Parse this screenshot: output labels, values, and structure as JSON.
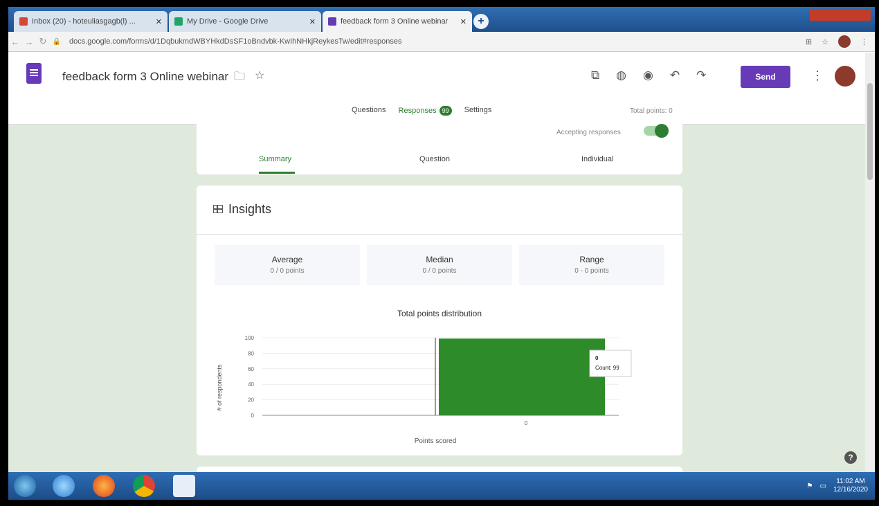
{
  "browser": {
    "tabs": [
      {
        "title": "Inbox (20) - hoteuliasgagb(l) ..."
      },
      {
        "title": "My Drive - Google Drive"
      },
      {
        "title": "feedback form 3 Online webinar"
      }
    ],
    "url": "docs.google.com/forms/d/1DqbukmdWBYHkdDsSF1oBndvbk-KwIhNHkjReykesTw/edit#responses"
  },
  "form": {
    "title": "feedback form 3 Online webinar",
    "send_label": "Send",
    "tabs": {
      "questions": "Questions",
      "responses": "Responses",
      "settings": "Settings"
    },
    "response_count": "99",
    "total_points": "Total points: 0",
    "accepting_label": "Accepting responses"
  },
  "responses": {
    "subtabs": {
      "summary": "Summary",
      "question": "Question",
      "individual": "Individual"
    },
    "insights_title": "Insights",
    "stats": [
      {
        "label": "Average",
        "value": "0 / 0 points"
      },
      {
        "label": "Median",
        "value": "0 / 0 points"
      },
      {
        "label": "Range",
        "value": "0 - 0 points"
      }
    ]
  },
  "chart_data": {
    "type": "bar",
    "title": "Total points distribution",
    "xlabel": "Points scored",
    "ylabel": "# of respondents",
    "categories": [
      "0"
    ],
    "values": [
      99
    ],
    "ylim": [
      0,
      100
    ],
    "yticks": [
      "0",
      "20",
      "40",
      "60",
      "80",
      "100"
    ],
    "bar_color": "#2e8b2a",
    "tooltip": {
      "category": "0",
      "text": "Count: 99"
    }
  },
  "taskbar": {
    "time": "11:02 AM",
    "date": "12/16/2020"
  },
  "colors": {
    "accent_purple": "#673ab7",
    "accent_green": "#2e7d32",
    "page_bg": "#dfeadc"
  }
}
